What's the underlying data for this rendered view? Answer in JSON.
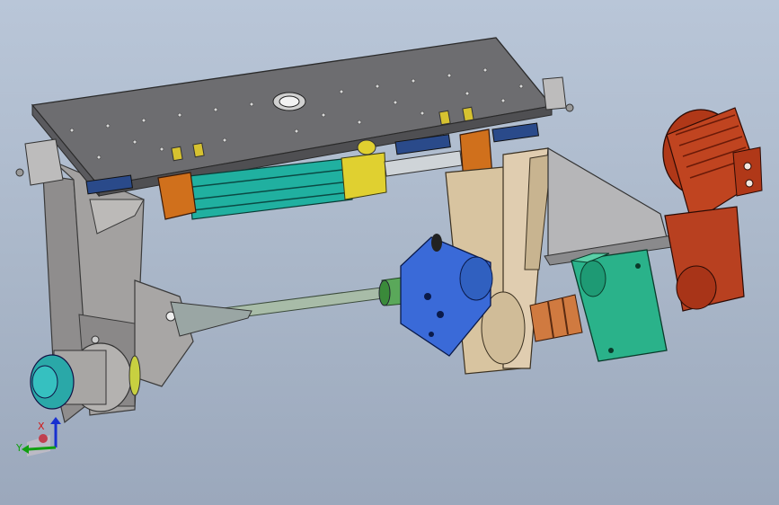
{
  "viewport": {
    "background_top": "#b9c6d8",
    "background_bottom": "#9ba8bc"
  },
  "triad": {
    "x_label": "X",
    "y_label": "Y",
    "x_color": "#d01818",
    "y_color": "#10a010",
    "z_color": "#1830d0"
  },
  "colors": {
    "plate": "#6d6d70",
    "frame": "#9a9898",
    "wood": "#d8c4a0",
    "blue_part": "#3a6ad8",
    "teal_part": "#20b0a0",
    "motor": "#b03818",
    "gearbox": "#2ab28a",
    "yellow_part": "#e0d030",
    "orange_part": "#d0701c",
    "rod": "#a8bca8"
  }
}
